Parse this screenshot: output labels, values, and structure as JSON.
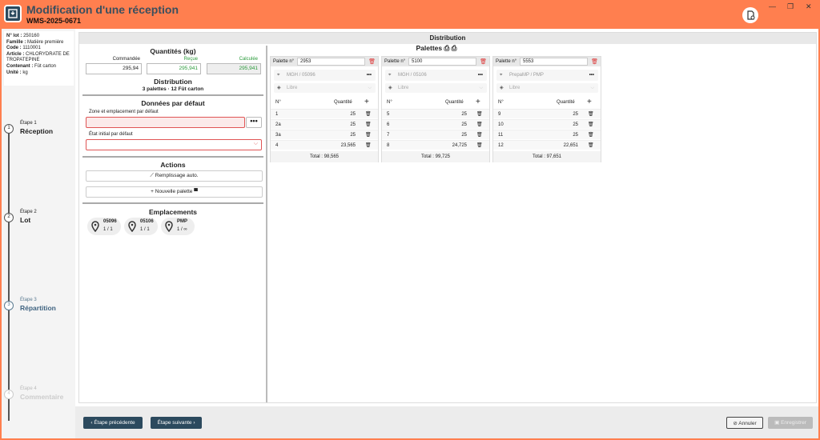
{
  "window": {
    "title": "Modification d'une réception",
    "subtitle": "WMS-2025-0671",
    "min": "—",
    "max": "❐",
    "close": "✕"
  },
  "lot": [
    {
      "k": "N° lot :",
      "v": " 250160"
    },
    {
      "k": "Famille :",
      "v": " Matière première"
    },
    {
      "k": "Code :",
      "v": " 1110001"
    },
    {
      "k": "Article :",
      "v": " CHLORYDRATE DE TROPATEPINE"
    },
    {
      "k": "Contenant :",
      "v": " Fût carton"
    },
    {
      "k": "Unité :",
      "v": " kg"
    }
  ],
  "steps": [
    {
      "label": "Étape 1",
      "name": "Réception",
      "num": "1"
    },
    {
      "label": "Étape 2",
      "name": "Lot",
      "num": "2"
    },
    {
      "label": "Étape 3",
      "name": "Répartition",
      "num": "3"
    },
    {
      "label": "Étape 4",
      "name": "Commentaire",
      "num": "4"
    }
  ],
  "header": "Distribution",
  "quantites": {
    "title": "Quantités (kg)",
    "commandee_lbl": "Commandée",
    "commandee": "295,94",
    "recue_lbl": "Reçue",
    "recue": "295,941",
    "calculee_lbl": "Calculée",
    "calculee": "295,941"
  },
  "distribution": {
    "title": "Distribution",
    "summary": "3 palettes · 12 Fût carton"
  },
  "defaut": {
    "title": "Données par défaut",
    "zone_lbl": "Zone et emplacement par défaut",
    "etat_lbl": "État initial par défaut",
    "dots": "•••"
  },
  "actions": {
    "title": "Actions",
    "auto": "Remplissage auto.",
    "nouvelle": "Nouvelle palette"
  },
  "emplacements": {
    "title": "Emplacements",
    "items": [
      {
        "name": "05096",
        "val": "1 / 1"
      },
      {
        "name": "05106",
        "val": "1 / 1"
      },
      {
        "name": "PMP",
        "val": "1 / ∞"
      }
    ]
  },
  "palettes": {
    "title": "Palettes",
    "num_lbl": "Palette n°",
    "n_hdr": "N°",
    "q_hdr": "Quantité",
    "total_lbl": "Total :",
    "items": [
      {
        "num": "2953",
        "loc": "MGH / 05096",
        "etat": "Libre",
        "rows": [
          [
            "1",
            "25"
          ],
          [
            "2a",
            "25"
          ],
          [
            "3a",
            "25"
          ],
          [
            "4",
            "23,565"
          ]
        ],
        "total": "98,565"
      },
      {
        "num": "5100",
        "loc": "MGH / 05106",
        "etat": "Libre",
        "rows": [
          [
            "5",
            "25"
          ],
          [
            "6",
            "25"
          ],
          [
            "7",
            "25"
          ],
          [
            "8",
            "24,725"
          ]
        ],
        "total": "99,725"
      },
      {
        "num": "5553",
        "loc": "PrepaMP / PMP",
        "etat": "Libre",
        "rows": [
          [
            "9",
            "25"
          ],
          [
            "10",
            "25"
          ],
          [
            "11",
            "25"
          ],
          [
            "12",
            "22,651"
          ]
        ],
        "total": "97,651"
      }
    ]
  },
  "footer": {
    "prev": "Étape précédente",
    "next": "Étape suivante",
    "cancel": "Annuler",
    "save": "Enregistrer"
  }
}
